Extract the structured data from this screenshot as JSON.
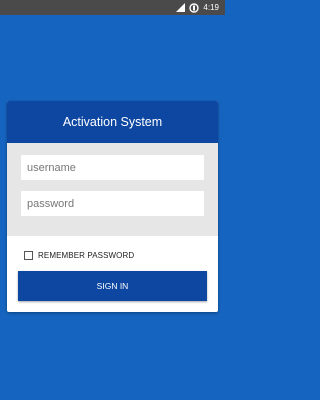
{
  "status_bar": {
    "time": "4:19",
    "icons": [
      "signal-icon",
      "battery-icon"
    ]
  },
  "login": {
    "title": "Activation System",
    "username_placeholder": "username",
    "password_placeholder": "password",
    "remember_label": "REMEMBER PASSWORD",
    "remember_checked": false,
    "sign_in_label": "SIGN IN"
  },
  "colors": {
    "background": "#1565c0",
    "header": "#0d47a1",
    "button": "#0d47a1",
    "status_bar": "#4a4a4a"
  }
}
